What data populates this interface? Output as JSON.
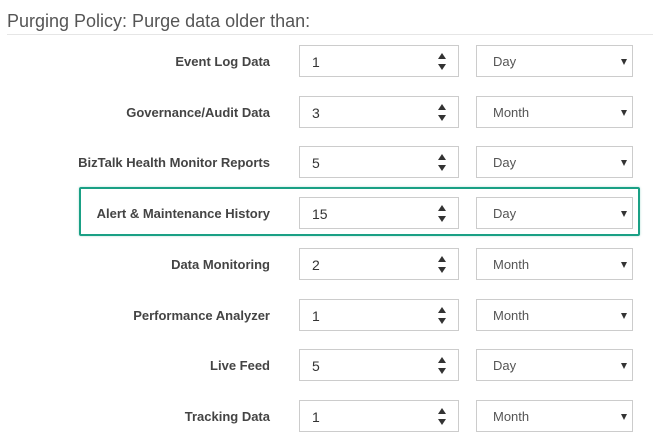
{
  "section": {
    "title": "Purging Policy: Purge data older than:"
  },
  "colors": {
    "highlight": "#1aa085",
    "label": "#444444",
    "border": "#cccccc"
  },
  "rows": [
    {
      "label": "Event Log Data",
      "value": "1",
      "unit": "Day"
    },
    {
      "label": "Governance/Audit Data",
      "value": "3",
      "unit": "Month"
    },
    {
      "label": "BizTalk Health Monitor Reports",
      "value": "5",
      "unit": "Day"
    },
    {
      "label": "Alert & Maintenance History",
      "value": "15",
      "unit": "Day",
      "highlighted": true
    },
    {
      "label": "Data Monitoring",
      "value": "2",
      "unit": "Month"
    },
    {
      "label": "Performance Analyzer",
      "value": "1",
      "unit": "Month"
    },
    {
      "label": "Live Feed",
      "value": "5",
      "unit": "Day"
    },
    {
      "label": "Tracking Data",
      "value": "1",
      "unit": "Month"
    }
  ]
}
